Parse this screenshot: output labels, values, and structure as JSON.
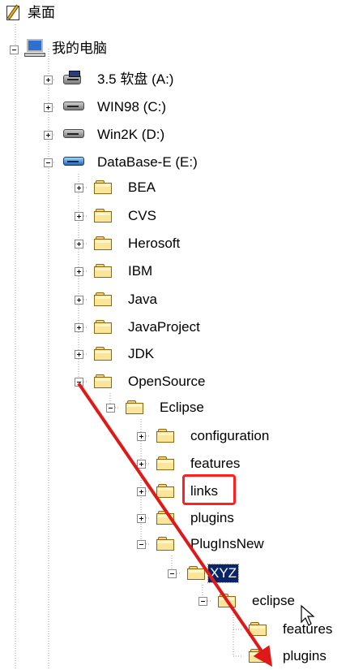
{
  "tree": {
    "desktop_label": "桌面",
    "computer_label": "我的电脑",
    "drives": [
      {
        "label": "3.5 软盘 (A:)"
      },
      {
        "label": "WIN98 (C:)"
      },
      {
        "label": "Win2K (D:)"
      },
      {
        "label": "DataBase-E (E:)"
      }
    ],
    "e_folders": [
      "BEA",
      "CVS",
      "Herosoft",
      "IBM",
      "Java",
      "JavaProject",
      "JDK",
      "OpenSource"
    ],
    "opensource_child": "Eclipse",
    "eclipse_children": [
      "configuration",
      "features",
      "links",
      "plugins",
      "PlugInsNew"
    ],
    "pluginsnew_child": "XYZ",
    "xyz_child": "eclipse",
    "inner_eclipse_children": [
      "features",
      "plugins"
    ]
  },
  "annotations": {
    "highlight_color": "#ff2020",
    "arrow_color": "#e01818"
  }
}
